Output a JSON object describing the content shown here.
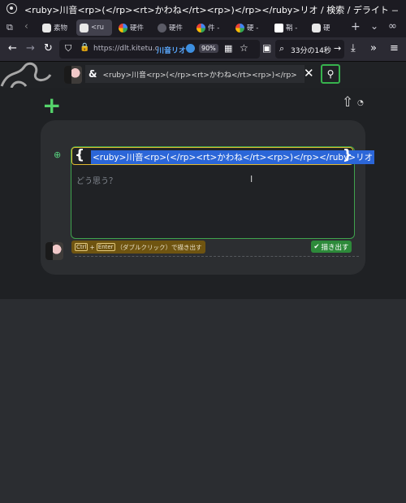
{
  "window": {
    "title": "<ruby>川音<rp>(</rp><rt>かわね</rt><rp>)</rp></ruby>リオ / 検索 / デライト — Mozilla Firefox"
  },
  "tabs": [
    {
      "label": "素物"
    },
    {
      "label": "<ru"
    },
    {
      "label": "硬件"
    },
    {
      "label": "硬件"
    },
    {
      "label": "件 -"
    },
    {
      "label": "硬 -"
    },
    {
      "label": "鞘 -"
    },
    {
      "label": "硬"
    }
  ],
  "nav": {
    "url": "https://dlt.kitetu.c",
    "user_badge": "川音リオ",
    "zoom": "90%",
    "search_text": "33分の14秒"
  },
  "header": {
    "amp": "&",
    "search_value": "<ruby>川音<rp>(</rp><rt>かわね</rt><rp>)</rp></ruby>リオ",
    "clear_symbol": "✕",
    "search_icon_glyph": "⚲"
  },
  "toolbar": {
    "plus_symbol": "+",
    "share_symbol": "⇧",
    "rss_symbol": "◔"
  },
  "composer": {
    "brace_open": "{",
    "brace_close": "}",
    "title": "<ruby>川音<rp>(</rp><rt>かわね</rt><rp>)</rp></ruby>リオ",
    "placeholder": "どう思う？",
    "hint_key1": "Ctrl",
    "hint_plus": "+",
    "hint_key2": "Enter",
    "hint_text": "（ダブルクリック）で描き出す",
    "post_label": "描き出す",
    "post_check": "✔"
  },
  "colors": {
    "accent_green": "#37b24d",
    "title_border": "#e1b930",
    "selection_blue": "#2b66d8"
  }
}
